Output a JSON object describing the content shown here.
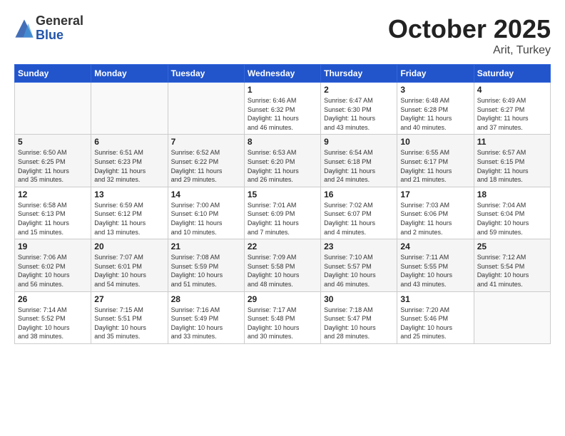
{
  "logo": {
    "general": "General",
    "blue": "Blue"
  },
  "title": "October 2025",
  "subtitle": "Arit, Turkey",
  "weekdays": [
    "Sunday",
    "Monday",
    "Tuesday",
    "Wednesday",
    "Thursday",
    "Friday",
    "Saturday"
  ],
  "weeks": [
    [
      {
        "day": "",
        "info": ""
      },
      {
        "day": "",
        "info": ""
      },
      {
        "day": "",
        "info": ""
      },
      {
        "day": "1",
        "info": "Sunrise: 6:46 AM\nSunset: 6:32 PM\nDaylight: 11 hours\nand 46 minutes."
      },
      {
        "day": "2",
        "info": "Sunrise: 6:47 AM\nSunset: 6:30 PM\nDaylight: 11 hours\nand 43 minutes."
      },
      {
        "day": "3",
        "info": "Sunrise: 6:48 AM\nSunset: 6:28 PM\nDaylight: 11 hours\nand 40 minutes."
      },
      {
        "day": "4",
        "info": "Sunrise: 6:49 AM\nSunset: 6:27 PM\nDaylight: 11 hours\nand 37 minutes."
      }
    ],
    [
      {
        "day": "5",
        "info": "Sunrise: 6:50 AM\nSunset: 6:25 PM\nDaylight: 11 hours\nand 35 minutes."
      },
      {
        "day": "6",
        "info": "Sunrise: 6:51 AM\nSunset: 6:23 PM\nDaylight: 11 hours\nand 32 minutes."
      },
      {
        "day": "7",
        "info": "Sunrise: 6:52 AM\nSunset: 6:22 PM\nDaylight: 11 hours\nand 29 minutes."
      },
      {
        "day": "8",
        "info": "Sunrise: 6:53 AM\nSunset: 6:20 PM\nDaylight: 11 hours\nand 26 minutes."
      },
      {
        "day": "9",
        "info": "Sunrise: 6:54 AM\nSunset: 6:18 PM\nDaylight: 11 hours\nand 24 minutes."
      },
      {
        "day": "10",
        "info": "Sunrise: 6:55 AM\nSunset: 6:17 PM\nDaylight: 11 hours\nand 21 minutes."
      },
      {
        "day": "11",
        "info": "Sunrise: 6:57 AM\nSunset: 6:15 PM\nDaylight: 11 hours\nand 18 minutes."
      }
    ],
    [
      {
        "day": "12",
        "info": "Sunrise: 6:58 AM\nSunset: 6:13 PM\nDaylight: 11 hours\nand 15 minutes."
      },
      {
        "day": "13",
        "info": "Sunrise: 6:59 AM\nSunset: 6:12 PM\nDaylight: 11 hours\nand 13 minutes."
      },
      {
        "day": "14",
        "info": "Sunrise: 7:00 AM\nSunset: 6:10 PM\nDaylight: 11 hours\nand 10 minutes."
      },
      {
        "day": "15",
        "info": "Sunrise: 7:01 AM\nSunset: 6:09 PM\nDaylight: 11 hours\nand 7 minutes."
      },
      {
        "day": "16",
        "info": "Sunrise: 7:02 AM\nSunset: 6:07 PM\nDaylight: 11 hours\nand 4 minutes."
      },
      {
        "day": "17",
        "info": "Sunrise: 7:03 AM\nSunset: 6:06 PM\nDaylight: 11 hours\nand 2 minutes."
      },
      {
        "day": "18",
        "info": "Sunrise: 7:04 AM\nSunset: 6:04 PM\nDaylight: 10 hours\nand 59 minutes."
      }
    ],
    [
      {
        "day": "19",
        "info": "Sunrise: 7:06 AM\nSunset: 6:02 PM\nDaylight: 10 hours\nand 56 minutes."
      },
      {
        "day": "20",
        "info": "Sunrise: 7:07 AM\nSunset: 6:01 PM\nDaylight: 10 hours\nand 54 minutes."
      },
      {
        "day": "21",
        "info": "Sunrise: 7:08 AM\nSunset: 5:59 PM\nDaylight: 10 hours\nand 51 minutes."
      },
      {
        "day": "22",
        "info": "Sunrise: 7:09 AM\nSunset: 5:58 PM\nDaylight: 10 hours\nand 48 minutes."
      },
      {
        "day": "23",
        "info": "Sunrise: 7:10 AM\nSunset: 5:57 PM\nDaylight: 10 hours\nand 46 minutes."
      },
      {
        "day": "24",
        "info": "Sunrise: 7:11 AM\nSunset: 5:55 PM\nDaylight: 10 hours\nand 43 minutes."
      },
      {
        "day": "25",
        "info": "Sunrise: 7:12 AM\nSunset: 5:54 PM\nDaylight: 10 hours\nand 41 minutes."
      }
    ],
    [
      {
        "day": "26",
        "info": "Sunrise: 7:14 AM\nSunset: 5:52 PM\nDaylight: 10 hours\nand 38 minutes."
      },
      {
        "day": "27",
        "info": "Sunrise: 7:15 AM\nSunset: 5:51 PM\nDaylight: 10 hours\nand 35 minutes."
      },
      {
        "day": "28",
        "info": "Sunrise: 7:16 AM\nSunset: 5:49 PM\nDaylight: 10 hours\nand 33 minutes."
      },
      {
        "day": "29",
        "info": "Sunrise: 7:17 AM\nSunset: 5:48 PM\nDaylight: 10 hours\nand 30 minutes."
      },
      {
        "day": "30",
        "info": "Sunrise: 7:18 AM\nSunset: 5:47 PM\nDaylight: 10 hours\nand 28 minutes."
      },
      {
        "day": "31",
        "info": "Sunrise: 7:20 AM\nSunset: 5:46 PM\nDaylight: 10 hours\nand 25 minutes."
      },
      {
        "day": "",
        "info": ""
      }
    ]
  ]
}
